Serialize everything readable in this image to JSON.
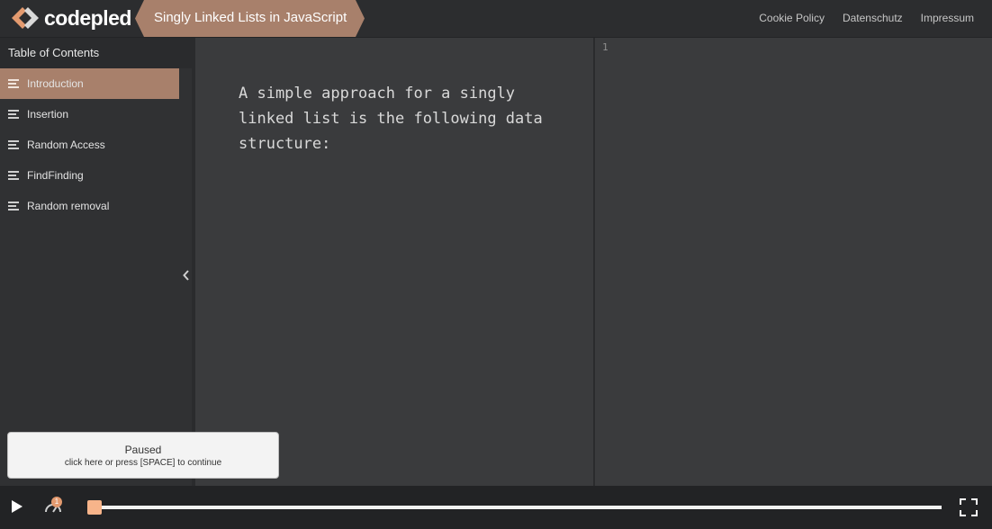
{
  "app": {
    "logo_text": "codepled",
    "page_title": "Singly Linked Lists in JavaScript",
    "brand_color": "#a8806b",
    "accent_color": "#f7b48a"
  },
  "topnav": {
    "items": [
      {
        "label": "Cookie Policy"
      },
      {
        "label": "Datenschutz"
      },
      {
        "label": "Impressum"
      }
    ]
  },
  "sidebar": {
    "header": "Table of Contents",
    "items": [
      {
        "label": "Introduction",
        "icon": "list-icon",
        "active": true
      },
      {
        "label": "Insertion",
        "icon": "list-icon",
        "active": false
      },
      {
        "label": "Random Access",
        "icon": "list-icon",
        "active": false
      },
      {
        "label": "FindFinding",
        "icon": "list-icon",
        "active": false
      },
      {
        "label": "Random removal",
        "icon": "list-icon",
        "active": false
      }
    ],
    "collapse_icon": "chevron-left-icon"
  },
  "content": {
    "text": "A simple approach for a singly linked list is the following data structure:"
  },
  "editor": {
    "line_numbers": [
      "1"
    ]
  },
  "paused": {
    "title": "Paused",
    "subtitle": "click here or press [SPACE] to continue"
  },
  "player": {
    "play_icon": "play-icon",
    "speed_icon": "speed-icon",
    "speed_badge": "1",
    "progress_fraction": 0.008,
    "fullscreen_icon": "fullscreen-icon"
  }
}
